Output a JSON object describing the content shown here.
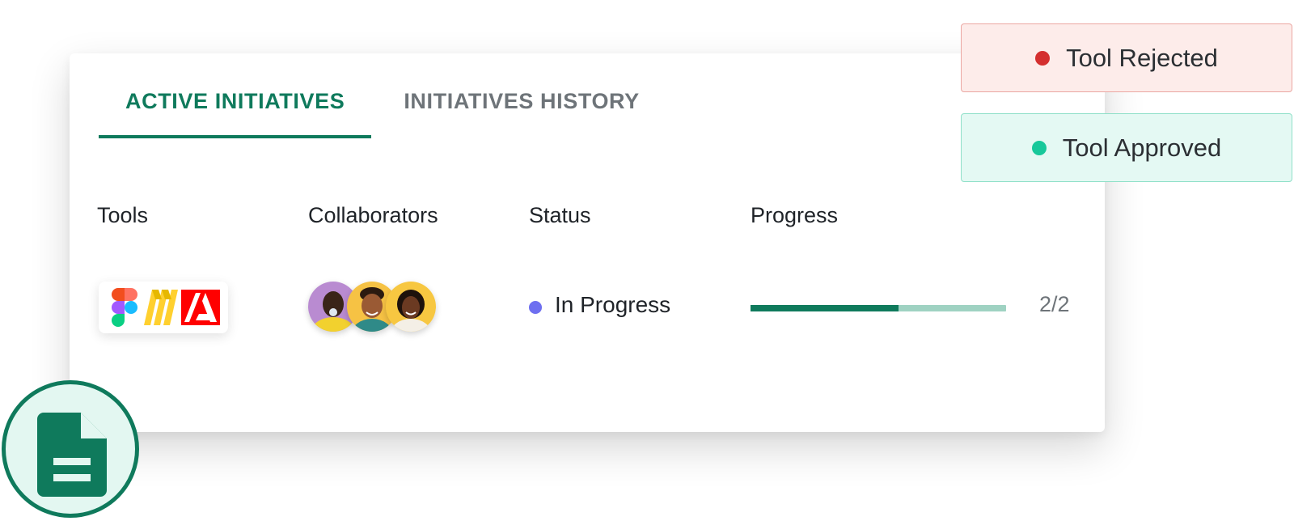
{
  "tabs": [
    {
      "label": "ACTIVE INITIATIVES",
      "active": true
    },
    {
      "label": "INITIATIVES HISTORY",
      "active": false
    }
  ],
  "columns": {
    "tools": "Tools",
    "collaborators": "Collaborators",
    "status": "Status",
    "progress": "Progress"
  },
  "row": {
    "tools": [
      "figma-icon",
      "miro-icon",
      "adobe-icon"
    ],
    "collaborators": [
      "avatar-purple",
      "avatar-yellow",
      "avatar-yellow-2"
    ],
    "status": "In Progress",
    "status_color": "#6e6ff0",
    "progress_fraction": 0.58,
    "progress_count": "2/2"
  },
  "chips": {
    "rejected": {
      "label": "Tool Rejected",
      "color": "#d42f2f"
    },
    "approved": {
      "label": "Tool Approved",
      "color": "#17c89a"
    }
  },
  "brand_color": "#0f7a5c",
  "badge_icon": "document-icon"
}
